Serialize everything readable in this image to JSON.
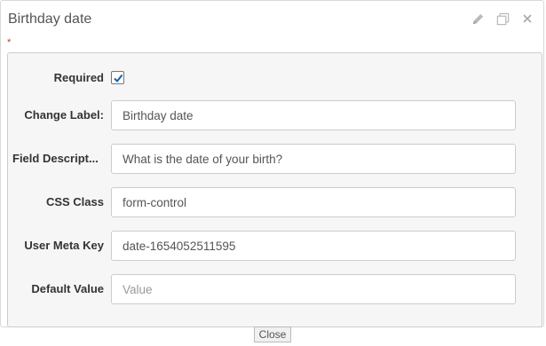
{
  "field": {
    "title": "Birthday date",
    "required_mark": "*",
    "actions": [
      "edit-icon",
      "copy-icon",
      "close-icon"
    ]
  },
  "form": {
    "required": {
      "label": "Required",
      "checked": true
    },
    "change_label": {
      "label": "Change Label:",
      "value": "Birthday date"
    },
    "field_description": {
      "label": "Field Descript...",
      "value": "What is the date of your birth?"
    },
    "css_class": {
      "label": "CSS Class",
      "value": "form-control"
    },
    "user_meta_key": {
      "label": "User Meta Key",
      "value": "date-1654052511595"
    },
    "default_value": {
      "label": "Default Value",
      "placeholder": "Value"
    }
  },
  "close_label": "Close",
  "colors": {
    "check": "#1a5fa8",
    "required": "#c0392b",
    "panel": "#f6f6f6"
  }
}
